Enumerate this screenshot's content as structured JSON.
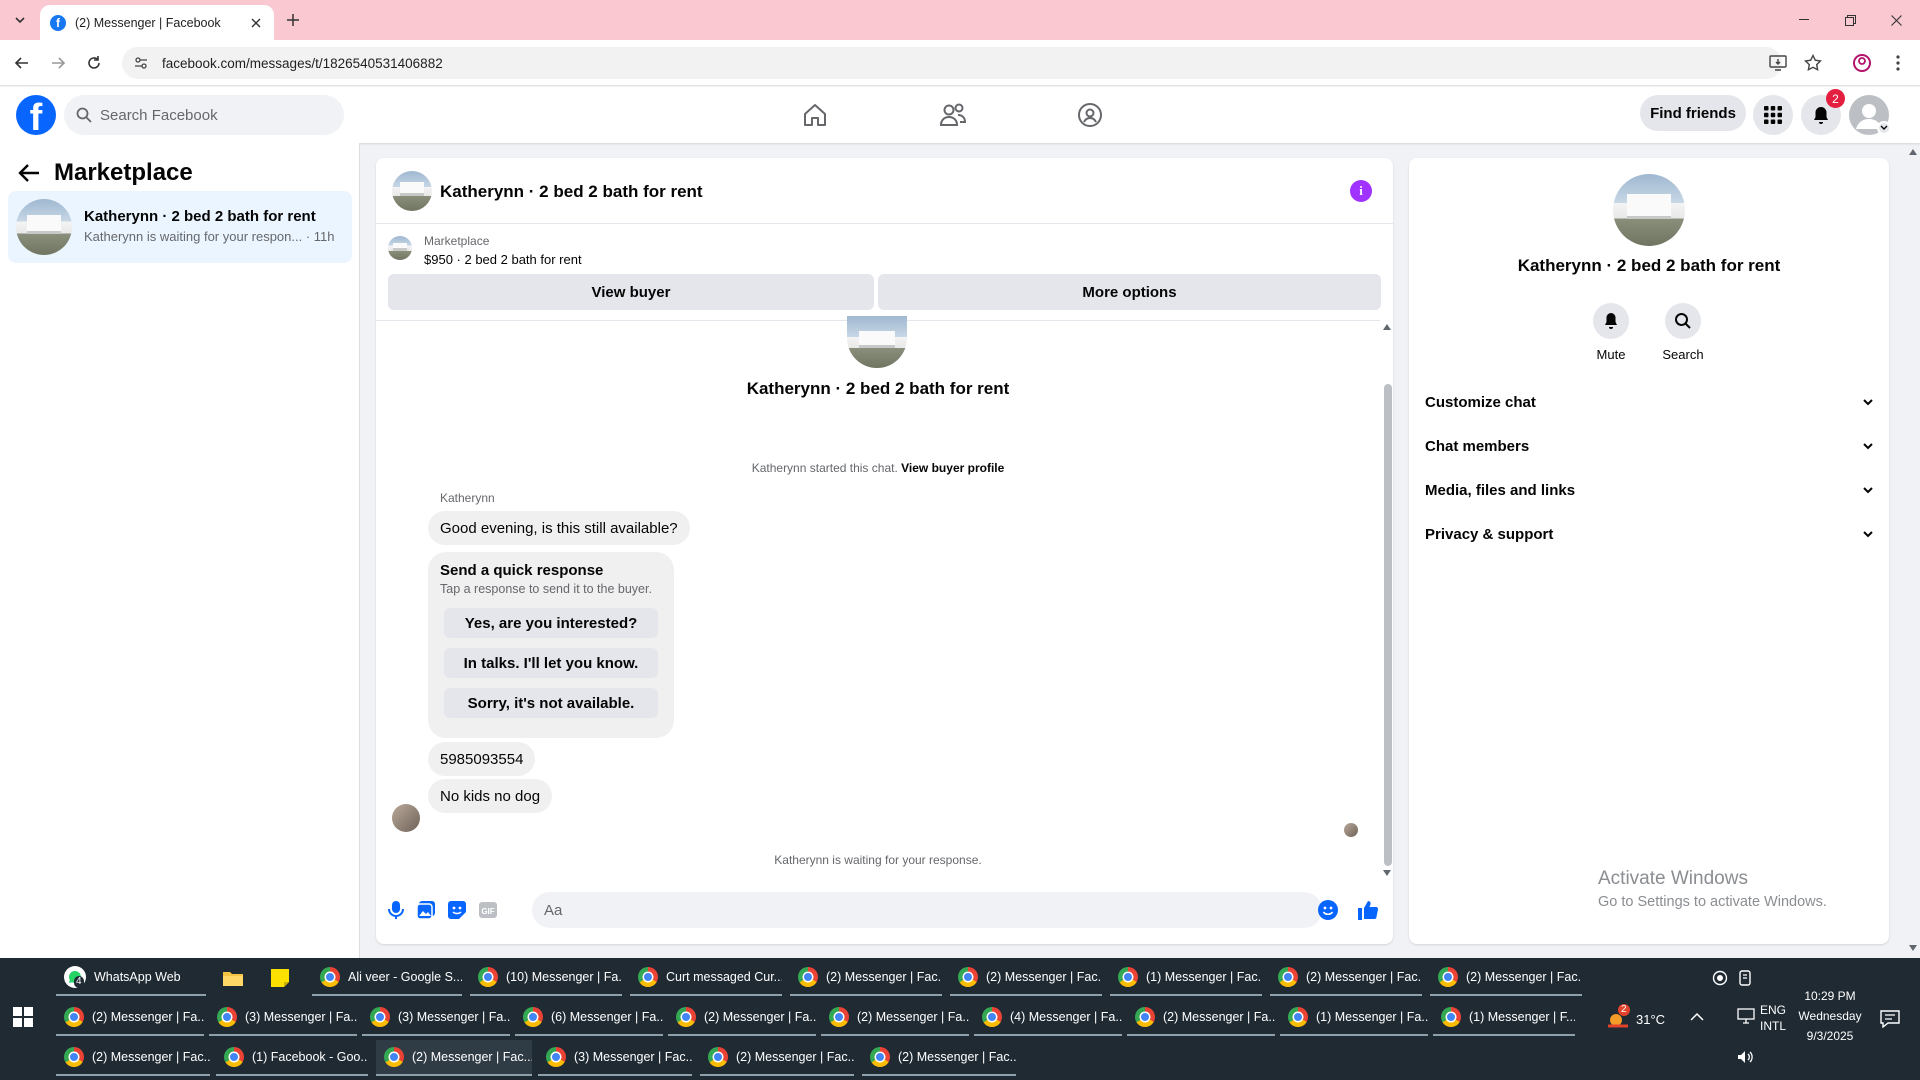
{
  "browser": {
    "tab_title": "(2) Messenger | Facebook",
    "url": "facebook.com/messages/t/1826540531406882"
  },
  "fb": {
    "search_placeholder": "Search Facebook",
    "find_friends": "Find friends",
    "notification_count": "2"
  },
  "sidebar": {
    "header": "Marketplace",
    "conversations": [
      {
        "title": "Katherynn · 2 bed 2 bath for rent",
        "preview": "Katherynn is waiting for your respon... · 11h"
      }
    ]
  },
  "chat": {
    "title": "Katherynn · 2 bed 2 bath for rent",
    "listing_category": "Marketplace",
    "listing_price": "$950 · 2 bed 2 bath for rent",
    "view_buyer": "View buyer",
    "more_options": "More options",
    "thread_name": "Katherynn · 2 bed 2 bath for rent",
    "started_text": "Katherynn started this chat.",
    "view_buyer_profile": "View buyer profile",
    "sender": "Katherynn",
    "messages": [
      "Good evening, is this still available?",
      "5985093554",
      "No kids no dog"
    ],
    "quick_response": {
      "title": "Send a quick response",
      "subtitle": "Tap a response to send it to the buyer.",
      "options": [
        "Yes, are you interested?",
        "In talks. I'll let you know.",
        "Sorry, it's not available."
      ]
    },
    "waiting": "Katherynn is waiting for your response.",
    "composer_placeholder": "Aa"
  },
  "info_panel": {
    "name": "Katherynn · 2 bed 2 bath for rent",
    "actions": [
      "Mute",
      "Search"
    ],
    "sections": [
      "Customize chat",
      "Chat members",
      "Media, files and links",
      "Privacy & support"
    ]
  },
  "watermark": {
    "line1": "Activate Windows",
    "line2": "Go to Settings to activate Windows."
  },
  "taskbar": {
    "row1": [
      "WhatsApp Web",
      "Ali veer - Google S...",
      "(10) Messenger | Fa...",
      "Curt messaged Cur...",
      "(2) Messenger | Fac...",
      "(2) Messenger | Fac...",
      "(1) Messenger | Fac...",
      "(2) Messenger | Fac...",
      "(2) Messenger | Fac..."
    ],
    "row2": [
      "(2) Messenger | Fa...",
      "(3) Messenger | Fa...",
      "(3) Messenger | Fa...",
      "(6) Messenger | Fa...",
      "(2) Messenger | Fa...",
      "(2) Messenger | Fa...",
      "(4) Messenger | Fa...",
      "(2) Messenger | Fa...",
      "(1) Messenger | Fa...",
      "(1) Messenger | F..."
    ],
    "row3": [
      "(2) Messenger | Fac...",
      "(1) Facebook - Goo...",
      "(2) Messenger | Fac...",
      "(3) Messenger | Fac...",
      "(2) Messenger | Fac...",
      "(2) Messenger | Fac..."
    ],
    "weather": "31°C",
    "weather_badge": "2",
    "lang1": "ENG",
    "lang2": "INTL",
    "time": "10:29 PM",
    "day": "Wednesday",
    "date": "9/3/2025",
    "whatsapp_badge": "4"
  }
}
